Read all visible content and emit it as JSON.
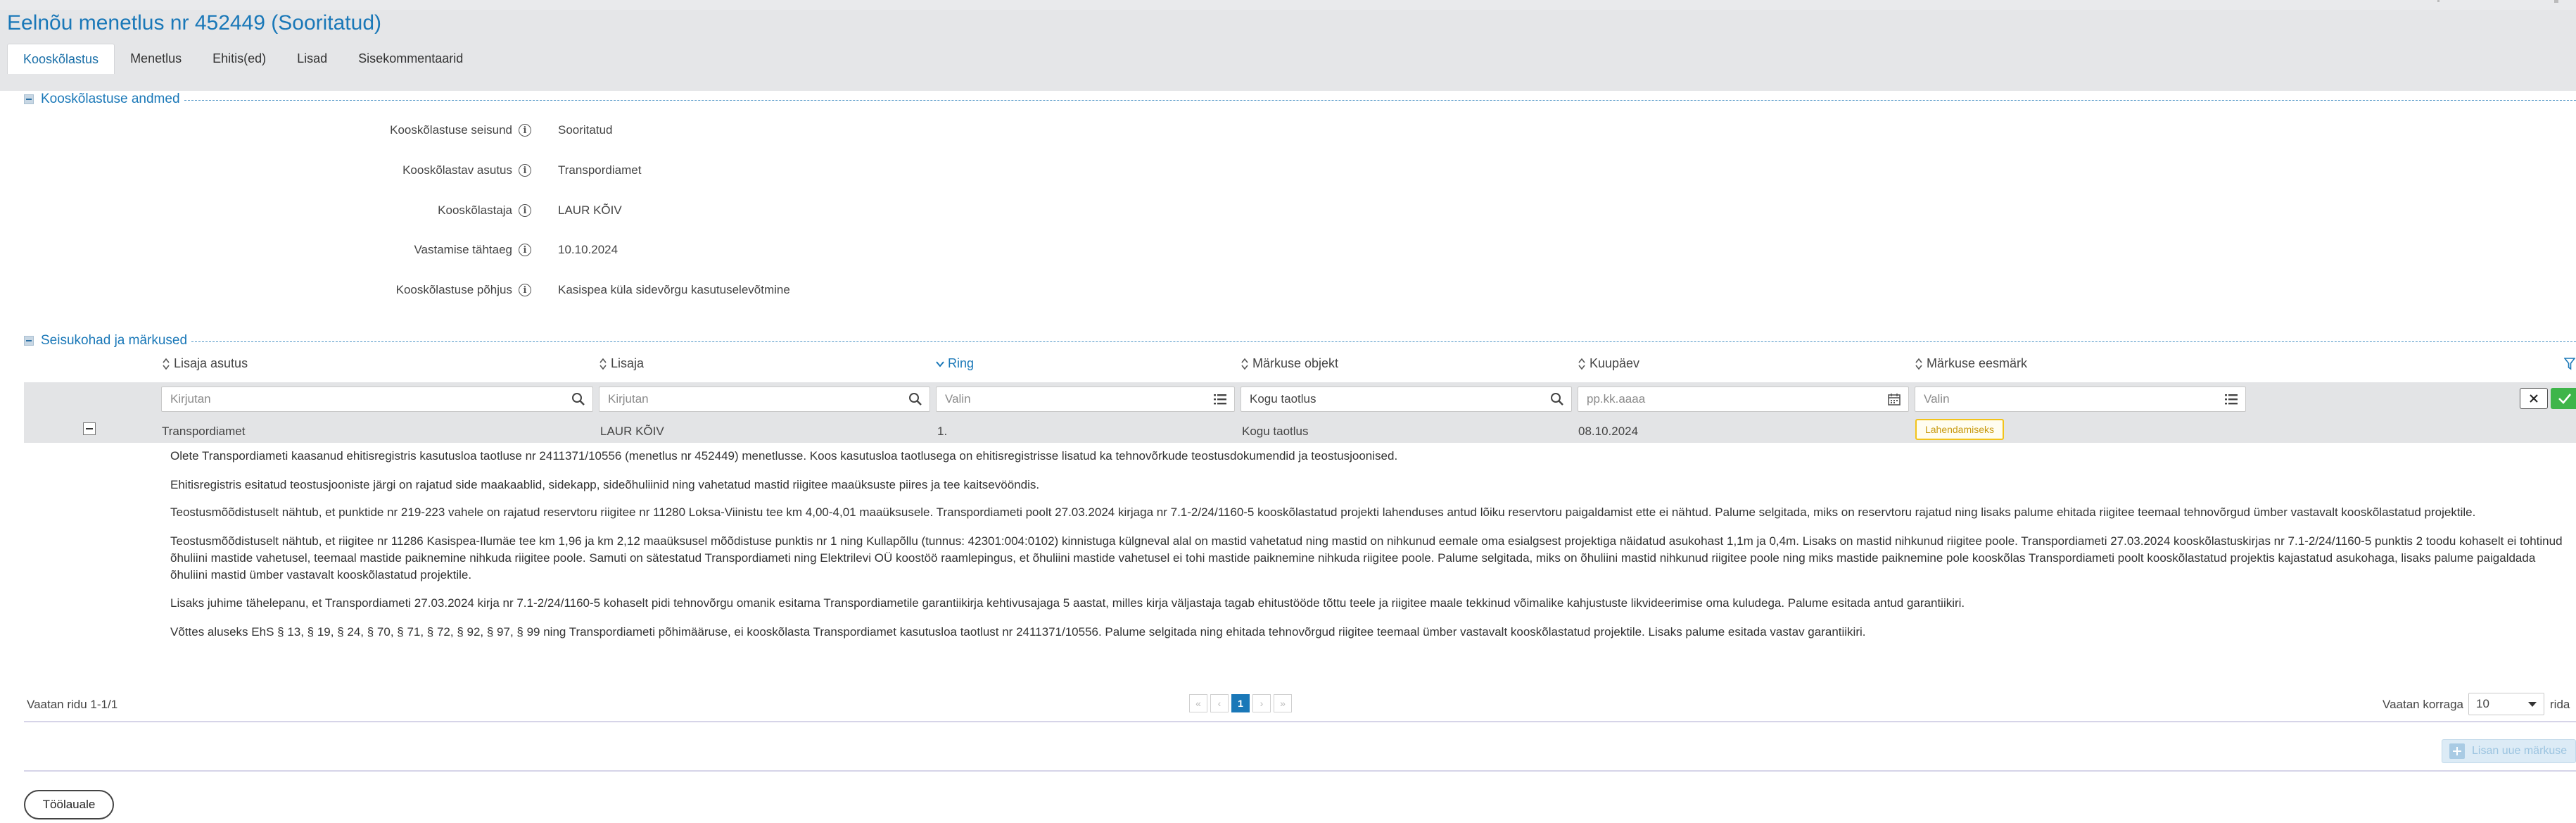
{
  "page_title": "Eelnõu menetlus nr 452449 (Sooritatud)",
  "tabs": [
    {
      "label": "Kooskõlastus",
      "active": true
    },
    {
      "label": "Menetlus",
      "active": false
    },
    {
      "label": "Ehitis(ed)",
      "active": false
    },
    {
      "label": "Lisad",
      "active": false
    },
    {
      "label": "Sisekommentaarid",
      "active": false
    }
  ],
  "section1": {
    "title": "Kooskõlastuse andmed",
    "fields": [
      {
        "label": "Kooskõlastuse seisund",
        "value": "Sooritatud"
      },
      {
        "label": "Kooskõlastav asutus",
        "value": "Transpordiamet"
      },
      {
        "label": "Kooskõlastaja",
        "value": "LAUR KÕIV"
      },
      {
        "label": "Vastamise tähtaeg",
        "value": "10.10.2024"
      },
      {
        "label": "Kooskõlastuse põhjus",
        "value": "Kasispea küla sidevõrgu kasutuselevõtmine"
      }
    ]
  },
  "section2": {
    "title": "Seisukohad ja märkused",
    "columns": [
      {
        "label": "Lisaja asutus",
        "sorted": false
      },
      {
        "label": "Lisaja",
        "sorted": false
      },
      {
        "label": "Ring",
        "sorted": true
      },
      {
        "label": "Märkuse objekt",
        "sorted": false
      },
      {
        "label": "Kuupäev",
        "sorted": false
      },
      {
        "label": "Märkuse eesmärk",
        "sorted": false
      }
    ],
    "filters": [
      {
        "placeholder": "Kirjutan",
        "value": "",
        "icon": "search-icon"
      },
      {
        "placeholder": "Kirjutan",
        "value": "",
        "icon": "search-icon"
      },
      {
        "placeholder": "Valin",
        "value": "",
        "icon": "list-icon"
      },
      {
        "placeholder": "Kogu taotlus",
        "value": "Kogu taotlus",
        "icon": "search-icon"
      },
      {
        "placeholder": "pp.kk.aaaa",
        "value": "",
        "icon": "calendar-icon"
      },
      {
        "placeholder": "Valin",
        "value": "",
        "icon": "list-icon"
      }
    ],
    "row": {
      "asutus": "Transpordiamet",
      "lisaja": "LAUR KÕIV",
      "ring": "1.",
      "objekt": "Kogu taotlus",
      "kuupaev": "08.10.2024",
      "eesmark_badge": "Lahendamiseks"
    },
    "comment_paragraphs": [
      "Olete Transpordiameti kaasanud ehitisregistris kasutusloa taotluse nr 2411371/10556 (menetlus nr 452449) menetlusse. Koos kasutusloa taotlusega on ehitisregistrisse lisatud ka tehnovõrkude teostusdokumendid ja teostusjoonised.",
      "Ehitisregistris esitatud teostusjooniste järgi on rajatud side maakaablid, sidekapp, sideõhuliinid ning vahetatud mastid riigitee maaüksuste piires ja tee kaitsevööndis.",
      "Teostusmõõdistuselt nähtub, et punktide nr 219-223 vahele on rajatud reservtoru riigitee nr 11280 Loksa-Viinistu tee km 4,00-4,01 maaüksusele. Transpordiameti poolt 27.03.2024 kirjaga nr 7.1-2/24/1160-5 kooskõlastatud projekti lahenduses antud lõiku reservtoru paigaldamist ette ei nähtud. Palume selgitada, miks on reservtoru rajatud ning lisaks palume ehitada riigitee teemaal tehnovõrgud ümber vastavalt kooskõlastatud projektile.",
      "Teostusmõõdistuselt nähtub, et riigitee nr 11286 Kasispea-Ilumäe tee km 1,96 ja km 2,12 maaüksusel mõõdistuse punktis nr 1 ning Kullapõllu (tunnus: 42301:004:0102) kinnistuga külgneval alal on mastid vahetatud ning mastid on nihkunud eemale oma esialgsest projektiga näidatud asukohast 1,1m ja 0,4m. Lisaks on mastid nihkunud riigitee poole. Transpordiameti 27.03.2024 kooskõlastuskirjas nr 7.1-2/24/1160-5 punktis 2 toodu kohaselt ei tohtinud õhuliini mastide vahetusel, teemaal mastide paiknemine nihkuda riigitee poole. Samuti on sätestatud Transpordiameti ning Elektrilevi OÜ koostöö raamlepingus, et õhuliini mastide vahetusel ei tohi mastide paiknemine nihkuda riigitee poole. Palume selgitada, miks on õhuliini mastid nihkunud riigitee poole ning miks mastide paiknemine pole kooskõlas Transpordiameti poolt kooskõlastatud projektis kajastatud asukohaga, lisaks palume paigaldada õhuliini mastid ümber vastavalt kooskõlastatud projektile.",
      "Lisaks juhime tähelepanu, et Transpordiameti 27.03.2024 kirja nr 7.1-2/24/1160-5 kohaselt pidi tehnovõrgu omanik esitama Transpordiametile garantiikirja kehtivusajaga 5 aastat, milles kirja väljastaja tagab ehitustööde tõttu teele ja riigitee maale tekkinud võimalike kahjustuste likvideerimise oma kuludega. Palume esitada antud garantiikiri.",
      "Võttes aluseks EhS § 13, § 19, § 24, § 70, § 71, § 72, § 92, § 97, § 99 ning Transpordiameti põhimääruse, ei kooskõlasta Transpordiamet kasutusloa taotlust nr 2411371/10556. Palume selgitada ning ehitada tehnovõrgud riigitee teemaal ümber vastavalt kooskõlastatud projektile. Lisaks palume esitada vastav garantiikiri."
    ]
  },
  "pagination": {
    "info": "Vaatan ridu 1-1/1",
    "current_page": "1",
    "page_size_label": "Vaatan korraga",
    "page_size": "10",
    "suffix": "rida"
  },
  "buttons": {
    "add_comment": "Lisan uue märkuse",
    "back": "Töölauale"
  },
  "colors": {
    "accent": "#1a78b8",
    "header_bg": "#e5e6e8",
    "badge_border": "#f2c31a",
    "ok_green": "#3eb54a"
  }
}
